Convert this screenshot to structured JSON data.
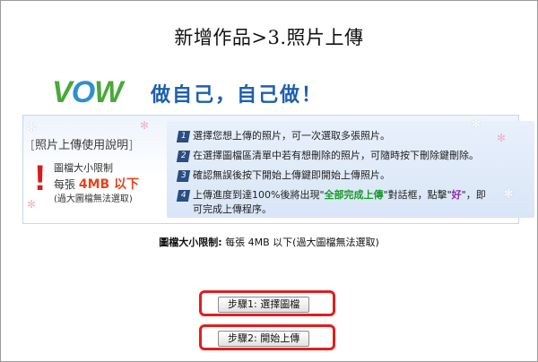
{
  "page": {
    "title": "新增作品>3.照片上傳",
    "logo_text_v": "V",
    "logo_text_o": "O",
    "logo_text_w": "W",
    "slogan": "做自己，自己做！"
  },
  "banner": {
    "instructions_title": "照片上傳使用說明",
    "warning": {
      "line1": "圖檔大小限制",
      "line2_prefix": "每張",
      "line2_size": "4MB 以下",
      "line3": "(過大圖檔無法選取)"
    },
    "steps": [
      {
        "num": "1",
        "text": "選擇您想上傳的照片，可一次選取多張照片。"
      },
      {
        "num": "2",
        "text": "在選擇圖檔區清單中若有想刪除的照片，可隨時按下刪除鍵刪除。"
      },
      {
        "num": "3",
        "text": "確認無誤後按下開始上傳鍵即開始上傳照片。"
      },
      {
        "num": "4",
        "text_a": "上傳進度到達100%後將出現\"",
        "text_hl1": "全部完成上傳",
        "text_b": "\"對話框，點擊\"",
        "text_hl2": "好",
        "text_c": "\"，即",
        "text_line2": "可完成上傳程序。"
      }
    ]
  },
  "size_limit": {
    "label": "圖檔大小限制:",
    "text": "每張 4MB 以下(過大圖檔無法選取)"
  },
  "buttons": {
    "select": "步驟1: 選擇圖檔",
    "start": "步驟2: 開始上傳"
  },
  "colors": {
    "highlight_box": "#e51c1c",
    "accent_blue": "#1d5fb0",
    "logo_green": "#4aa83a",
    "warning_red": "#d81c1c"
  }
}
